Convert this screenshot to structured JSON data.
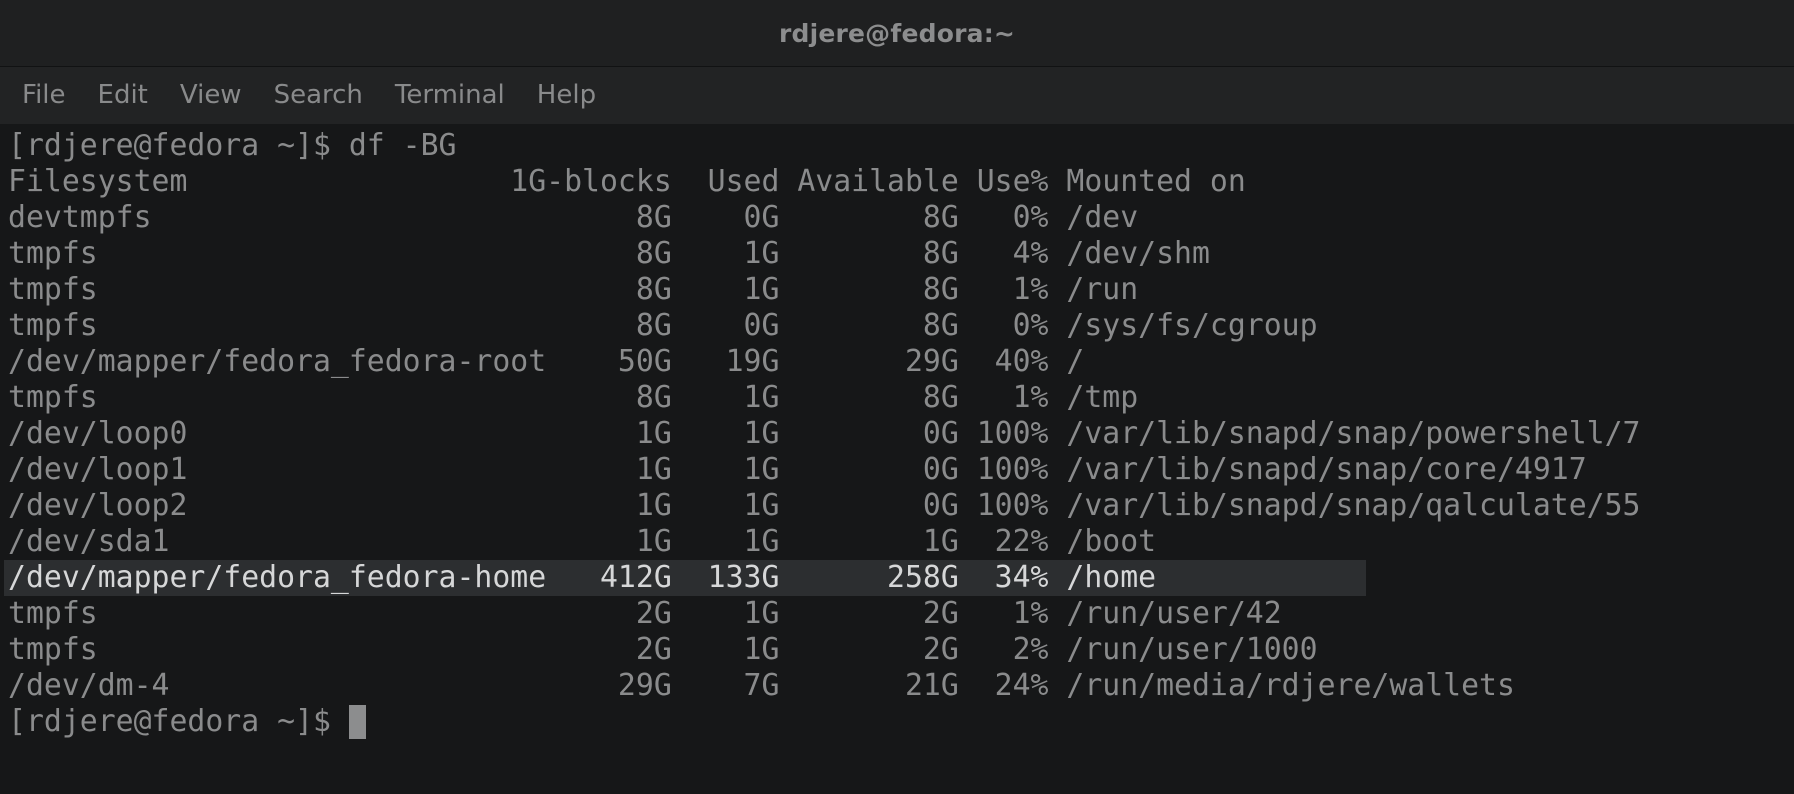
{
  "window": {
    "title": "rdjere@fedora:~"
  },
  "menu": {
    "items": [
      "File",
      "Edit",
      "View",
      "Search",
      "Terminal",
      "Help"
    ]
  },
  "terminal": {
    "command_line": "[rdjere@fedora ~]$ df -BG",
    "header": "Filesystem                  1G-blocks  Used Available Use% Mounted on",
    "rows": [
      "devtmpfs                           8G    0G        8G   0% /dev",
      "tmpfs                              8G    1G        8G   4% /dev/shm",
      "tmpfs                              8G    1G        8G   1% /run",
      "tmpfs                              8G    0G        8G   0% /sys/fs/cgroup",
      "/dev/mapper/fedora_fedora-root    50G   19G       29G  40% /",
      "tmpfs                              8G    1G        8G   1% /tmp",
      "/dev/loop0                         1G    1G        0G 100% /var/lib/snapd/snap/powershell/7",
      "/dev/loop1                         1G    1G        0G 100% /var/lib/snapd/snap/core/4917",
      "/dev/loop2                         1G    1G        0G 100% /var/lib/snapd/snap/qalculate/55",
      "/dev/sda1                          1G    1G        1G  22% /boot",
      "/dev/mapper/fedora_fedora-home   412G  133G      258G  34% /home",
      "tmpfs                              2G    1G        2G   1% /run/user/42",
      "tmpfs                              2G    1G        2G   2% /run/user/1000",
      "/dev/dm-4                         29G    7G       21G  24% /run/media/rdjere/wallets"
    ],
    "highlighted_row_index": 10,
    "prompt": "[rdjere@fedora ~]$ "
  },
  "colors": {
    "background": "#161718",
    "text": "#8a8b8c",
    "highlight_bg": "#2c2e30",
    "highlight_text": "#d6d7d8"
  }
}
